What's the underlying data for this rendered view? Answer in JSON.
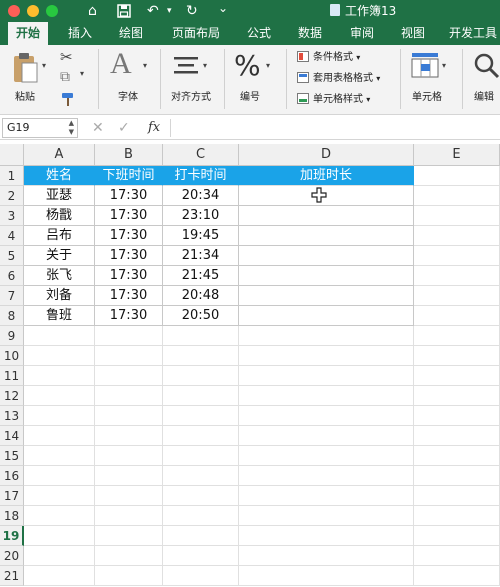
{
  "window": {
    "title": "工作簿13",
    "quick_access": [
      "home-icon",
      "save-icon",
      "undo-icon",
      "redo-icon",
      "more-icon"
    ],
    "undo_chevron": "▾",
    "more_glyph": "⌄"
  },
  "tabs": [
    "开始",
    "插入",
    "绘图",
    "页面布局",
    "公式",
    "数据",
    "审阅",
    "视图",
    "开发工具"
  ],
  "active_tab": "开始",
  "ribbon": {
    "paste": "粘贴",
    "font": "字体",
    "align": "对齐方式",
    "number": "编号",
    "cond_format": "条件格式",
    "table_format": "套用表格格式",
    "cell_style": "单元格样式",
    "cells": "单元格",
    "edit": "编辑",
    "dropdown_glyph": "▾",
    "font_glyph": "A",
    "percent_glyph": "%"
  },
  "formula_bar": {
    "name_box": "G19",
    "fx": "fx",
    "cancel_glyph": "✕",
    "enter_glyph": "✓",
    "formula": ""
  },
  "columns": [
    "A",
    "B",
    "C",
    "D",
    "E"
  ],
  "rows": [
    "1",
    "2",
    "3",
    "4",
    "5",
    "6",
    "7",
    "8",
    "9",
    "10",
    "11",
    "12",
    "13",
    "14",
    "15",
    "16",
    "17",
    "18",
    "19",
    "20",
    "21"
  ],
  "selected_row": "19",
  "table": {
    "header": [
      "姓名",
      "下班时间",
      "打卡时间",
      "加班时长"
    ],
    "rows": [
      [
        "亚瑟",
        "17:30",
        "20:34",
        ""
      ],
      [
        "杨戬",
        "17:30",
        "23:10",
        ""
      ],
      [
        "吕布",
        "17:30",
        "19:45",
        ""
      ],
      [
        "关于",
        "17:30",
        "21:34",
        ""
      ],
      [
        "张飞",
        "17:30",
        "21:45",
        ""
      ],
      [
        "刘备",
        "17:30",
        "20:48",
        ""
      ],
      [
        "鲁班",
        "17:30",
        "20:50",
        ""
      ]
    ]
  },
  "colors": {
    "brand": "#1f7145",
    "header_fill": "#1aa3e8"
  }
}
